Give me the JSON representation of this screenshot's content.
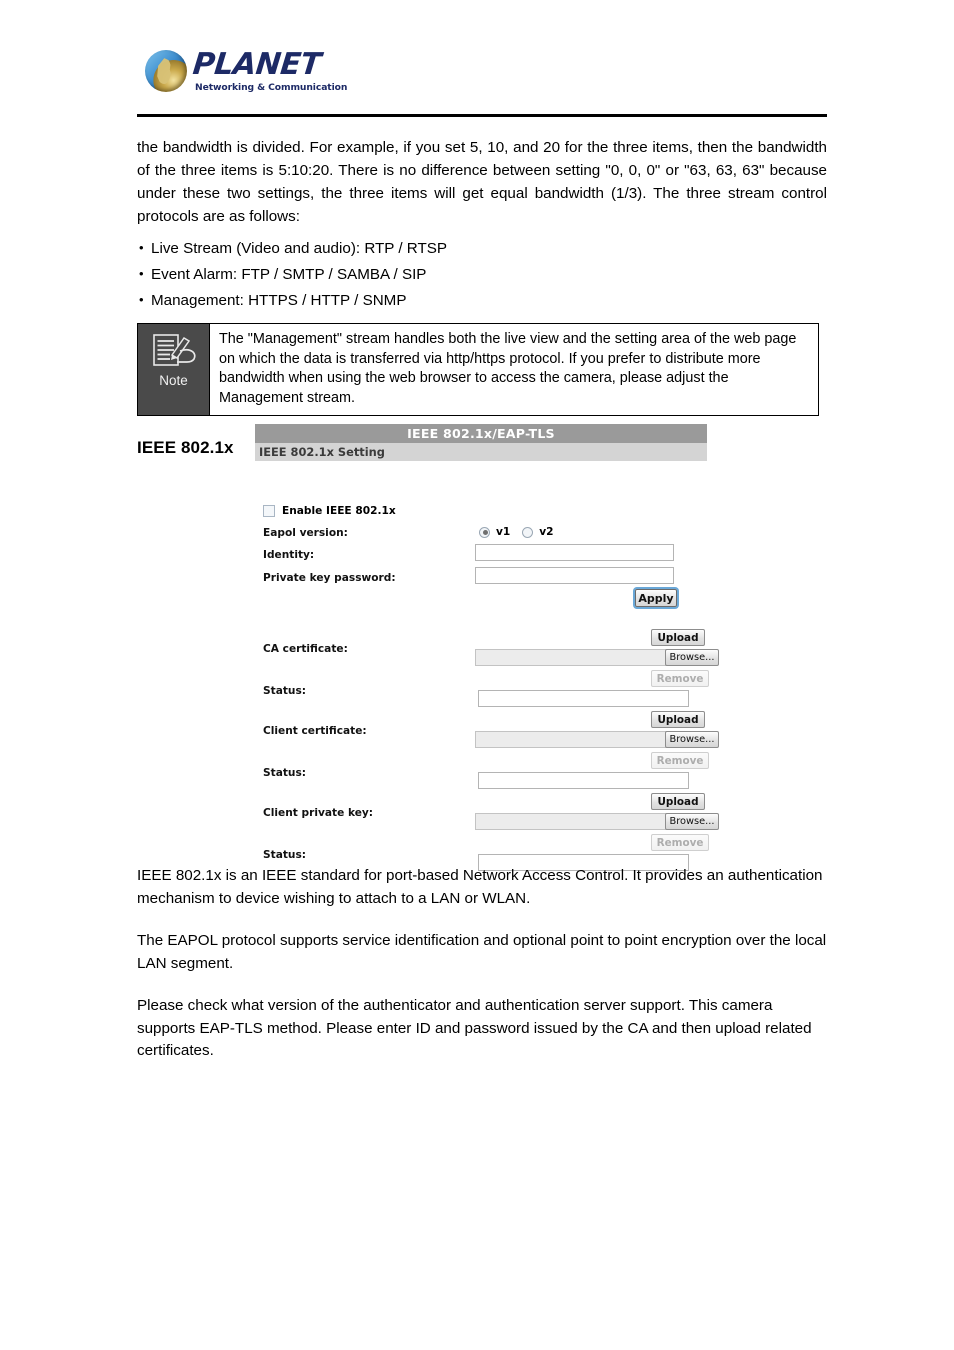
{
  "header": {
    "logo_name": "PLANET",
    "logo_tagline": "Networking & Communication"
  },
  "body": {
    "intro_paragraph": "the bandwidth is divided. For example, if you set 5, 10, and 20 for the three items, then the bandwidth of the three items is 5:10:20. There is no difference between setting \"0, 0, 0\" or \"63, 63, 63\" because under these two settings, the three items will get equal bandwidth (1/3). The three stream control protocols are as follows:",
    "bullets": [
      "Live Stream (Video and audio): RTP / RTSP",
      "Event Alarm: FTP /  SMTP / SAMBA  / SIP",
      "Management: HTTPS / HTTP / SNMP"
    ],
    "note": {
      "label": "Note",
      "icon": "note-pencil-writing-icon",
      "text": "The \"Management\" stream handles both the live view and the setting area of the web page on which the data is transferred via http/https protocol. If you prefer to distribute more bandwidth when using the web browser to access the camera, please adjust the Management stream."
    },
    "section_heading": "IEEE 802.1x",
    "closing_paragraphs": [
      "IEEE 802.1x is an IEEE standard for port-based Network Access Control. It provides an authentication mechanism to device wishing to attach to a LAN or WLAN.",
      "The EAPOL protocol supports service identification and optional point to point encryption over the local LAN segment.",
      "Please check what version of the authenticator and authentication server support. This camera supports EAP-TLS method. Please enter ID and password issued by the CA and then upload related certificates."
    ]
  },
  "panel": {
    "title": "IEEE 802.1x/EAP-TLS",
    "subtitle": "IEEE 802.1x Setting",
    "enable_checkbox_label": "Enable IEEE 802.1x",
    "enable_checkbox_checked": false,
    "eapol_label": "Eapol version:",
    "eapol_options": [
      {
        "label": "v1",
        "selected": true
      },
      {
        "label": "v2",
        "selected": false
      }
    ],
    "identity_label": "Identity:",
    "identity_value": "",
    "private_key_password_label": "Private key password:",
    "private_key_password_value": "",
    "apply_button": "Apply",
    "upload_button": "Upload",
    "browse_button": "Browse...",
    "remove_button": "Remove",
    "status_label": "Status:",
    "certificates": [
      {
        "label": "CA certificate:",
        "file_value": "",
        "status_value": ""
      },
      {
        "label": "Client certificate:",
        "file_value": "",
        "status_value": ""
      },
      {
        "label": "Client private key:",
        "file_value": "",
        "status_value": ""
      }
    ]
  },
  "colors": {
    "panel_title_bg": "#9a9a9a",
    "panel_subtitle_bg": "#d4d4d4",
    "note_icon_bg": "#4a4a4a",
    "logo_navy": "#1d2a66",
    "focus_ring": "#6aa8d8"
  }
}
